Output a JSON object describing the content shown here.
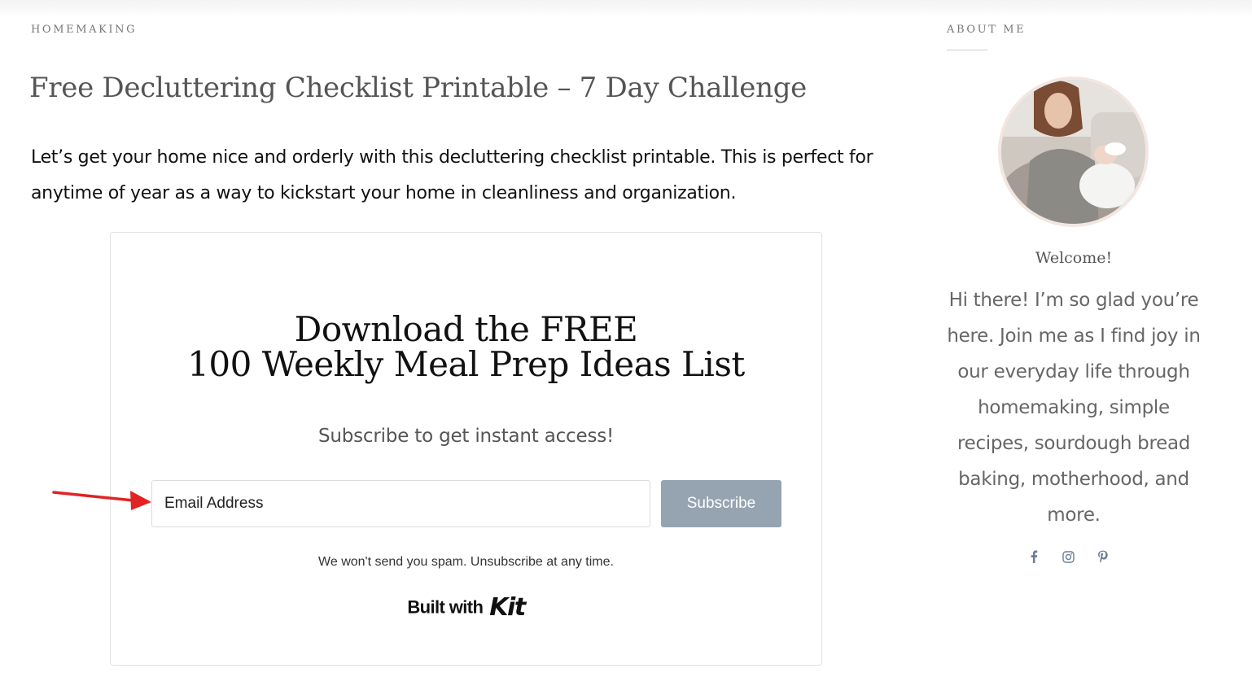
{
  "post": {
    "category": "HOMEMAKING",
    "title": "Free Decluttering Checklist Printable – 7 Day Challenge",
    "intro": "Let’s get your home nice and orderly with this decluttering checklist printable. This is perfect for anytime of year as a way to kickstart your home in cleanliness and organization."
  },
  "form": {
    "heading_line1": "Download the FREE",
    "heading_line2": "100 Weekly Meal Prep Ideas List",
    "subheading": "Subscribe to get instant access!",
    "email_placeholder": "Email Address",
    "subscribe_label": "Subscribe",
    "spam_note": "We won't send you spam. Unsubscribe at any time.",
    "built_with": "Built with",
    "brand": "Kit",
    "button_color": "#96a3b1"
  },
  "annotation": {
    "arrow_color": "#e02424",
    "points_to": "email-input"
  },
  "sidebar": {
    "title": "ABOUT ME",
    "welcome": "Welcome!",
    "bio": "Hi there! I’m so glad you’re here. Join me as I find joy in our everyday life through homemaking, simple recipes, sourdough bread baking, motherhood, and more.",
    "socials": [
      "facebook-icon",
      "instagram-icon",
      "pinterest-icon"
    ],
    "icon_color": "#6b7f95"
  }
}
